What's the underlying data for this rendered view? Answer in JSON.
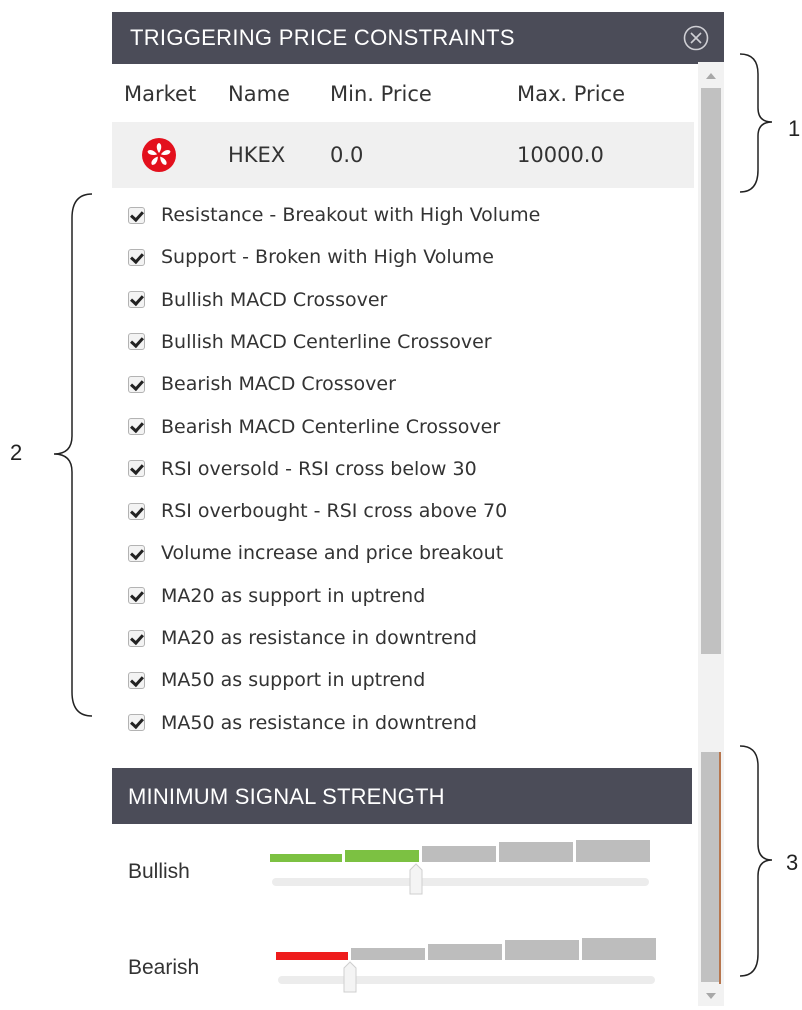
{
  "panel": {
    "title": "TRIGGERING PRICE CONSTRAINTS",
    "close_icon": "circle-x-icon"
  },
  "table": {
    "headers": {
      "market": "Market",
      "name": "Name",
      "min": "Min. Price",
      "max": "Max. Price"
    },
    "rows": [
      {
        "market_icon": "hong-kong-flag-icon",
        "name": "HKEX",
        "min": "0.0",
        "max": "10000.0"
      }
    ]
  },
  "signals": [
    {
      "label": "Resistance - Breakout with High Volume",
      "checked": true
    },
    {
      "label": "Support - Broken with High Volume",
      "checked": true
    },
    {
      "label": "Bullish MACD Crossover",
      "checked": true
    },
    {
      "label": "Bullish MACD Centerline Crossover",
      "checked": true
    },
    {
      "label": "Bearish MACD Crossover",
      "checked": true
    },
    {
      "label": "Bearish MACD Centerline Crossover",
      "checked": true
    },
    {
      "label": "RSI oversold - RSI cross below 30",
      "checked": true
    },
    {
      "label": "RSI overbought - RSI cross above 70",
      "checked": true
    },
    {
      "label": "Volume increase and price breakout",
      "checked": true
    },
    {
      "label": "MA20 as support in uptrend",
      "checked": true
    },
    {
      "label": "MA20 as resistance in downtrend",
      "checked": true
    },
    {
      "label": "MA50 as support in uptrend",
      "checked": true
    },
    {
      "label": "MA50 as resistance in downtrend",
      "checked": true
    }
  ],
  "strength": {
    "title": "MINIMUM SIGNAL STRENGTH",
    "bullish": {
      "label": "Bullish",
      "level": 2,
      "max": 5,
      "color": "#7cc142"
    },
    "bearish": {
      "label": "Bearish",
      "level": 1,
      "max": 5,
      "color": "#ee1c1c"
    },
    "inactive_color": "#bdbdbd"
  },
  "annotations": {
    "one": "1",
    "two": "2",
    "three": "3"
  },
  "colors": {
    "header_bg": "#4b4c58",
    "row_bg": "#f0f0f0"
  }
}
